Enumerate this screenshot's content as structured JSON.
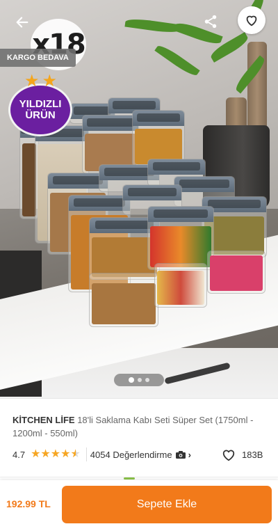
{
  "hero": {
    "quantity_badge": "x18",
    "shipping_badge": "KARGO BEDAVA",
    "star_badge_line1": "YILDIZLI",
    "star_badge_line2": "ÜRÜN",
    "carousel": {
      "total": 3,
      "active": 1
    }
  },
  "product": {
    "brand": "KİTCHEN LİFE",
    "name": "18'li Saklama Kabı Seti Süper Set (1750ml - 1200ml - 550ml)"
  },
  "rating": {
    "score": "4.7",
    "stars_value": 4.7,
    "reviews_label": "4054 Değerlendirme",
    "favorites_count": "183B"
  },
  "bottom": {
    "price": "192.99 TL",
    "add_to_cart_label": "Sepete Ekle"
  },
  "colors": {
    "accent": "#f27a1a",
    "star": "#f6a623",
    "badge_purple": "#6b1fa0"
  },
  "icons": {
    "back": "arrow-left-icon",
    "share": "share-icon",
    "favorite": "heart-icon",
    "camera": "camera-icon",
    "chevron": "chevron-right-icon"
  }
}
